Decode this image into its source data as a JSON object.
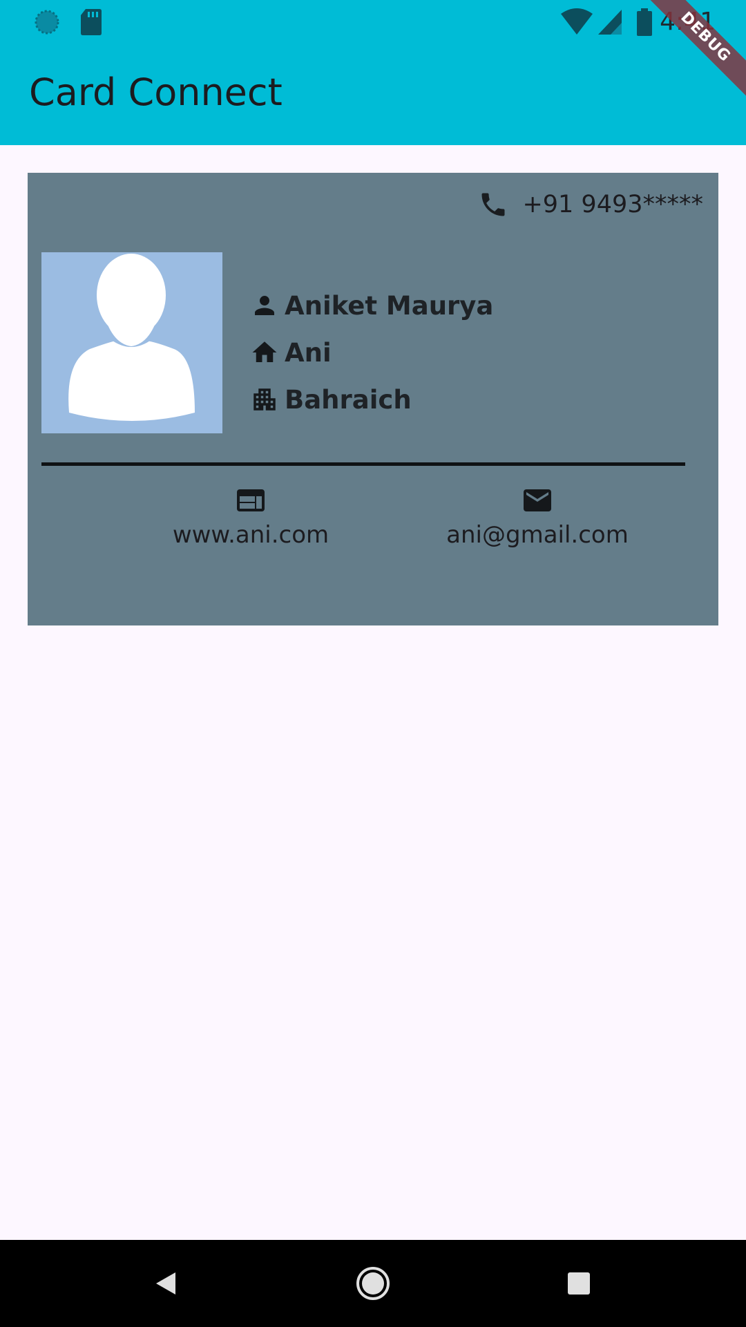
{
  "status_bar": {
    "time": "4:41",
    "icons": [
      "sync-icon",
      "sd-card-icon",
      "wifi-icon",
      "cell-signal-icon",
      "battery-icon"
    ]
  },
  "debug_banner": "DEBUG",
  "app_bar": {
    "title": "Card Connect"
  },
  "card": {
    "phone": "+91 9493*****",
    "phone_icon": "phone-icon",
    "avatar_icon": "person-silhouette-icon",
    "name": "Aniket Maurya",
    "nickname": "Ani",
    "city": "Bahraich",
    "website": "www.ani.com",
    "email": "ani@gmail.com"
  },
  "navigation": {
    "buttons": [
      "back-icon",
      "home-icon",
      "recents-icon"
    ]
  },
  "colors": {
    "app_bar": "#00BCD6",
    "background": "#FDF7FF",
    "card": "#647D8A",
    "avatar_bg": "#9BBCE2",
    "debug_ribbon": "#88323C"
  }
}
